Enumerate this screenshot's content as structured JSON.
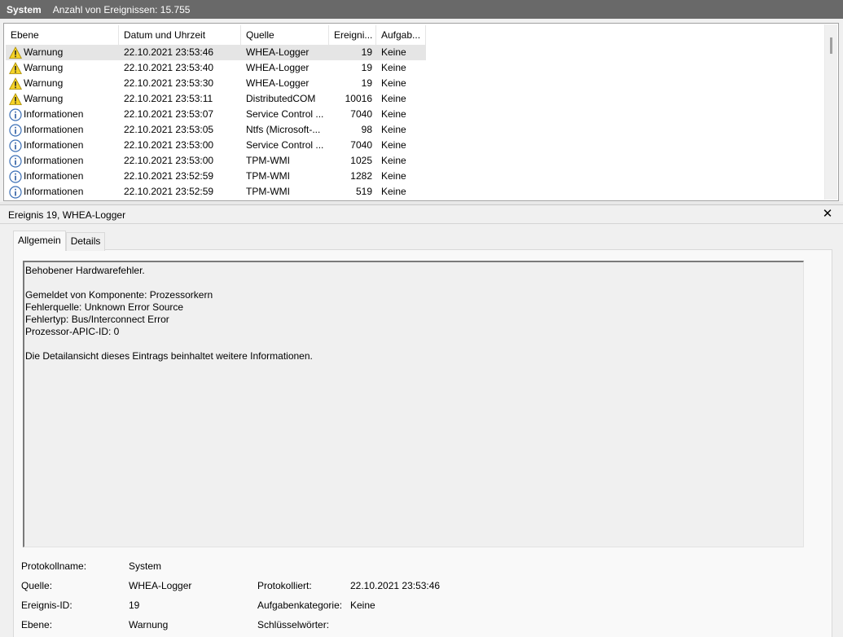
{
  "titlebar": {
    "title": "System",
    "count_label": "Anzahl von Ereignissen: 15.755"
  },
  "columns": [
    {
      "label": "Ebene",
      "width": 139
    },
    {
      "label": "Datum und Uhrzeit",
      "width": 150
    },
    {
      "label": "Quelle",
      "width": 108
    },
    {
      "label": "Ereigni...",
      "width": 58
    },
    {
      "label": "Aufgab...",
      "width": 61
    }
  ],
  "events": [
    {
      "level": "Warnung",
      "icon": "warning-icon",
      "date": "22.10.2021 23:53:46",
      "source": "WHEA-Logger",
      "id": "19",
      "task": "Keine",
      "selected": true
    },
    {
      "level": "Warnung",
      "icon": "warning-icon",
      "date": "22.10.2021 23:53:40",
      "source": "WHEA-Logger",
      "id": "19",
      "task": "Keine"
    },
    {
      "level": "Warnung",
      "icon": "warning-icon",
      "date": "22.10.2021 23:53:30",
      "source": "WHEA-Logger",
      "id": "19",
      "task": "Keine"
    },
    {
      "level": "Warnung",
      "icon": "warning-icon",
      "date": "22.10.2021 23:53:11",
      "source": "DistributedCOM",
      "id": "10016",
      "task": "Keine"
    },
    {
      "level": "Informationen",
      "icon": "info-icon",
      "date": "22.10.2021 23:53:07",
      "source": "Service Control ...",
      "id": "7040",
      "task": "Keine"
    },
    {
      "level": "Informationen",
      "icon": "info-icon",
      "date": "22.10.2021 23:53:05",
      "source": "Ntfs (Microsoft-...",
      "id": "98",
      "task": "Keine"
    },
    {
      "level": "Informationen",
      "icon": "info-icon",
      "date": "22.10.2021 23:53:00",
      "source": "Service Control ...",
      "id": "7040",
      "task": "Keine"
    },
    {
      "level": "Informationen",
      "icon": "info-icon",
      "date": "22.10.2021 23:53:00",
      "source": "TPM-WMI",
      "id": "1025",
      "task": "Keine"
    },
    {
      "level": "Informationen",
      "icon": "info-icon",
      "date": "22.10.2021 23:52:59",
      "source": "TPM-WMI",
      "id": "1282",
      "task": "Keine"
    },
    {
      "level": "Informationen",
      "icon": "info-icon",
      "date": "22.10.2021 23:52:59",
      "source": "TPM-WMI",
      "id": "519",
      "task": "Keine"
    }
  ],
  "detail": {
    "header": "Ereignis 19, WHEA-Logger",
    "tabs": [
      {
        "label": "Allgemein"
      },
      {
        "label": "Details"
      }
    ],
    "description_lines": [
      "Behobener Hardwarefehler.",
      "",
      "Gemeldet von Komponente: Prozessorkern",
      "Fehlerquelle: Unknown Error Source",
      "Fehlertyp: Bus/Interconnect Error",
      "Prozessor-APIC-ID: 0",
      "",
      "Die Detailansicht dieses Eintrags beinhaltet weitere Informationen."
    ],
    "props": {
      "logname_label": "Protokollname:",
      "logname_value": "System",
      "source_label": "Quelle:",
      "source_value": "WHEA-Logger",
      "logged_label": "Protokolliert:",
      "logged_value": "22.10.2021 23:53:46",
      "eventid_label": "Ereignis-ID:",
      "eventid_value": "19",
      "taskcat_label": "Aufgabenkategorie:",
      "taskcat_value": "Keine",
      "level_label": "Ebene:",
      "level_value": "Warnung",
      "keywords_label": "Schlüsselwörter:",
      "keywords_value": ""
    }
  }
}
